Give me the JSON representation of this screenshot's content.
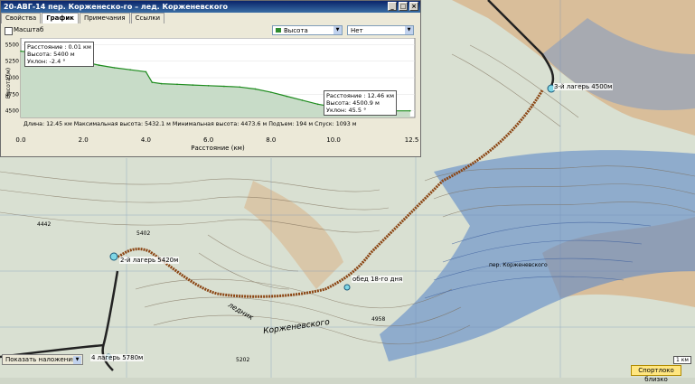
{
  "window": {
    "title": "20-АВГ-14 пер. Корженеско-го – лед. Корженевского",
    "tabs": [
      "Свойства",
      "График",
      "Примечания",
      "Ссылки"
    ],
    "active_tab": "График"
  },
  "toolbar": {
    "scale_label": "Масштаб",
    "y_select": "Высота",
    "second_select": "Нет"
  },
  "tooltip_start": {
    "distance": "Расстояние : 0.01 км",
    "altitude": "Высота: 5400 м",
    "slope": "Уклон: -2.4 °"
  },
  "tooltip_end": {
    "distance": "Расстояние : 12.46 км",
    "altitude": "Высота: 4500.9 м",
    "slope": "Уклон: 45.5 °"
  },
  "stats": "Длина: 12.45 км    Максимальная высота: 5432.1 м    Минимальная высота: 4473.6 м    Подъем: 194 м    Спуск: 1093 м",
  "chart_data": {
    "type": "area",
    "xlabel": "Расстояние (км)",
    "ylabel": "Высота (м)",
    "xlim": [
      0,
      12.6
    ],
    "ylim": [
      4400,
      5600
    ],
    "xticks": [
      "0.0",
      "2.0",
      "4.0",
      "6.0",
      "8.0",
      "10.0",
      "12.5"
    ],
    "yticks": [
      "5500",
      "5250",
      "5000",
      "4750",
      "4500"
    ],
    "x": [
      0,
      0.5,
      1.0,
      1.5,
      2.0,
      2.5,
      3.0,
      3.5,
      4.0,
      4.2,
      4.5,
      5.0,
      5.5,
      6.0,
      6.5,
      7.0,
      7.5,
      8.0,
      8.5,
      9.0,
      9.5,
      10.0,
      10.5,
      11.0,
      11.5,
      12.0,
      12.45
    ],
    "values": [
      5400,
      5380,
      5340,
      5300,
      5240,
      5190,
      5150,
      5120,
      5090,
      4930,
      4910,
      4900,
      4890,
      4880,
      4870,
      4860,
      4830,
      4780,
      4720,
      4660,
      4600,
      4560,
      4530,
      4510,
      4500,
      4500,
      4500
    ],
    "color": "#1e8c1e",
    "fill": "#c8dcc8"
  },
  "map": {
    "labels": {
      "camp3": "3-й лагерь 4500м",
      "camp2": "2-й лагерь 5420м",
      "camp4": "4 лагерь 5780м",
      "lunch": "обед 18-го дня",
      "glacier": "Корженевского",
      "glacier2": "ледник",
      "pass": "пер. Корженевского",
      "h1": "5402",
      "h2": "4958",
      "h3": "5202",
      "h4": "4442"
    }
  },
  "bottom": {
    "overlay": "Показать наложения",
    "nearby": "Спортлоко близко",
    "scale": "1 км"
  }
}
